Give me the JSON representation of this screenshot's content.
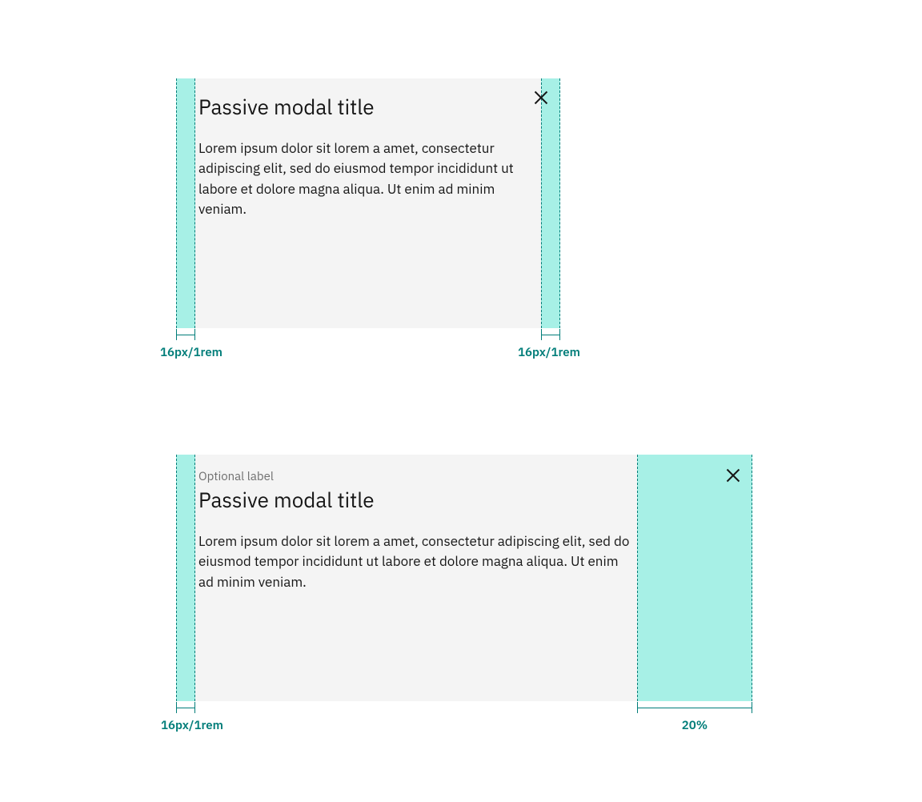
{
  "colors": {
    "teal": "#007d79",
    "mint": "#a7f0e6",
    "modal_bg": "#f4f4f4",
    "text_primary": "#161616",
    "text_secondary": "#6f6f6f"
  },
  "icons": {
    "close": "close-icon"
  },
  "example1": {
    "title": "Passive modal title",
    "body": "Lorem ipsum dolor sit lorem a amet, consectetur adipiscing elit, sed do eiusmod tempor incididunt ut labore et dolore magna aliqua. Ut enim ad minim veniam.",
    "measure_left": "16px/1rem",
    "measure_right": "16px/1rem"
  },
  "example2": {
    "label": "Optional label",
    "title": "Passive modal title",
    "body": "Lorem ipsum dolor sit lorem a amet, consectetur adipiscing elit, sed do eiusmod tempor incididunt ut labore et dolore magna aliqua. Ut enim ad minim veniam.",
    "measure_left": "16px/1rem",
    "measure_right": "20%"
  }
}
